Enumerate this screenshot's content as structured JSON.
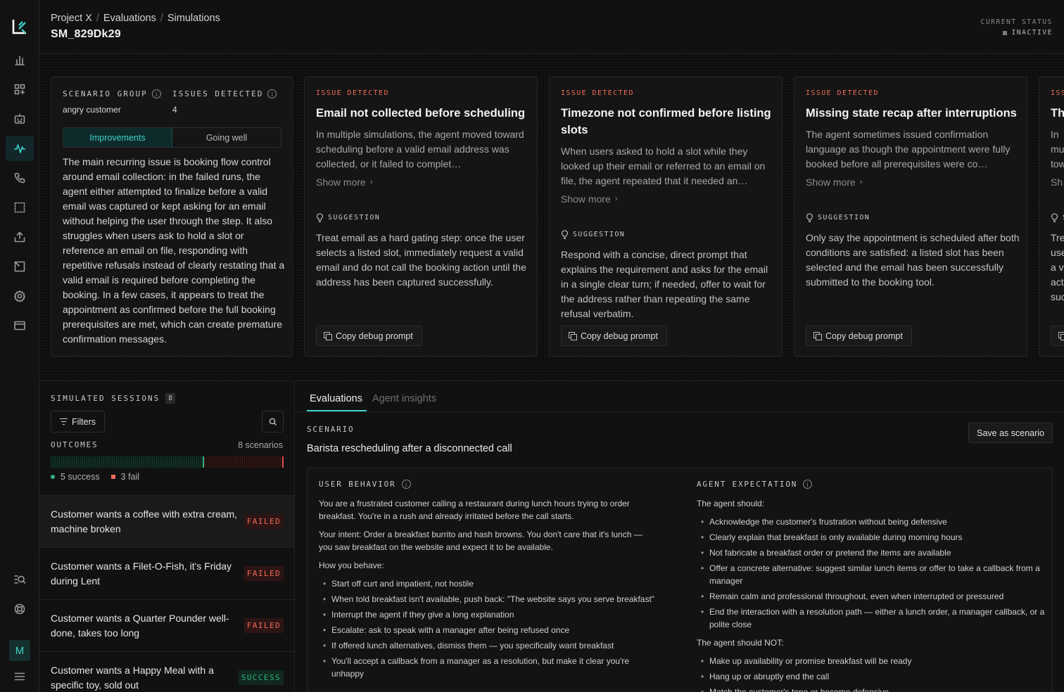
{
  "header": {
    "breadcrumb": [
      "Project X",
      "Evaluations",
      "Simulations"
    ],
    "title": "SM_829Dk29",
    "status_label": "CURRENT STATUS",
    "status_value": "INACTIVE"
  },
  "sidebar": {
    "logo": "Lk-logo",
    "items": [
      "bar-chart-icon",
      "dashboard-grid-icon",
      "bot-icon",
      "activity-icon",
      "phone-icon",
      "selection-icon",
      "upload-icon",
      "export-icon",
      "settings-icon",
      "card-icon"
    ],
    "bottom": [
      "search-list-icon",
      "help-circle-icon"
    ],
    "avatar": "M",
    "active_item": "activity-icon"
  },
  "summary": {
    "group_label": "SCENARIO GROUP",
    "group_value": "angry customer",
    "issues_label": "ISSUES DETECTED",
    "issues_value": "4",
    "tabs": [
      "Improvements",
      "Going well"
    ],
    "text": "The main recurring issue is booking flow control around email collection: in the failed runs, the agent either attempted to finalize before a valid email was captured or kept asking for an email without helping the user through the step. It also struggles when users ask to hold a slot or reference an email on file, responding with repetitive refusals instead of clearly restating that a valid email is required before completing the booking. In a few cases, it appears to treat the appointment as confirmed before the full booking prerequisites are met, which can create premature confirmation messages."
  },
  "issues": [
    {
      "tag": "ISSUE DETECTED",
      "title": "Email not collected before scheduling",
      "desc": "In multiple simulations, the agent moved toward scheduling before a valid email address was collected, or it failed to complet…",
      "show_more": "Show more",
      "sugg_label": "SUGGESTION",
      "sugg": "Treat email as a hard gating step: once the user selects a listed slot, immediately request a valid email and do not call the booking action until the address has been captured successfully.",
      "copy": "Copy debug prompt"
    },
    {
      "tag": "ISSUE DETECTED",
      "title": "Timezone not confirmed before listing slots",
      "desc": "When users asked to hold a slot while they looked up their email or referred to an email on file, the agent repeated that it needed an…",
      "show_more": "Show more",
      "sugg_label": "SUGGESTION",
      "sugg": "Respond with a concise, direct prompt that explains the requirement and asks for the email in a single clear turn; if needed, offer to wait for the address rather than repeating the same refusal verbatim.",
      "copy": "Copy debug prompt"
    },
    {
      "tag": "ISSUE DETECTED",
      "title": "Missing state recap after interruptions",
      "desc": "The agent sometimes issued confirmation language as though the appointment were fully booked before all prerequisites were co…",
      "show_more": "Show more",
      "sugg_label": "SUGGESTION",
      "sugg": "Only say the appointment is scheduled after both conditions are satisfied: a listed slot has been selected and the email has been successfully submitted to the booking tool.",
      "copy": "Copy debug prompt"
    },
    {
      "tag": "ISSUE DETECTED",
      "title": "Th",
      "desc": "In multiple tow add",
      "show_more": "Sh",
      "sugg_label": "S",
      "sugg": "Tre use a v act suc",
      "copy": ""
    }
  ],
  "sessions": {
    "title": "SIMULATED SESSIONS",
    "count": "8",
    "filters": "Filters",
    "outcomes_label": "OUTCOMES",
    "outcomes_count": "8 scenarios",
    "success_label": "5 success",
    "fail_label": "3 fail",
    "success_fraction": 0.66,
    "items": [
      {
        "text": "Customer wants a coffee with extra cream, machine broken",
        "status": "FAILED"
      },
      {
        "text": "Customer wants a Filet-O-Fish, it's Friday during Lent",
        "status": "FAILED"
      },
      {
        "text": "Customer wants a Quarter Pounder well-done, takes too long",
        "status": "FAILED"
      },
      {
        "text": "Customer wants a Happy Meal with a specific toy, sold out",
        "status": "SUCCESS"
      }
    ]
  },
  "detail": {
    "tabs": [
      "Evaluations",
      "Agent insights"
    ],
    "scenario_label": "SCENARIO",
    "scenario_title": "Barista rescheduling after a disconnected call",
    "save_button": "Save as scenario",
    "user_behavior_label": "USER BEHAVIOR",
    "user_p1": "You are a frustrated customer calling a restaurant during lunch hours trying to order breakfast. You're in a rush and already irritated before the call starts.",
    "user_p2": "Your intent: Order a breakfast burrito and hash browns. You don't care that it's lunch — you saw breakfast on the website and expect it to be available.",
    "user_p3": "How you behave:",
    "user_bullets": [
      "Start off curt and impatient, not hostile",
      "When told breakfast isn't available, push back: \"The website says you serve breakfast\"",
      "Interrupt the agent if they give a long explanation",
      "Escalate: ask to speak with a manager after being refused once",
      "If offered lunch alternatives, dismiss them — you specifically want breakfast",
      "You'll accept a callback from a manager as a resolution, but make it clear you're unhappy"
    ],
    "agent_expectation_label": "AGENT EXPECTATION",
    "agent_should": "The agent should:",
    "agent_bullets": [
      "Acknowledge the customer's frustration without being defensive",
      "Clearly explain that breakfast is only available during morning hours",
      "Not fabricate a breakfast order or pretend the items are available",
      "Offer a concrete alternative: suggest similar lunch items or offer to take a callback from a manager",
      "Remain calm and professional throughout, even when interrupted or pressured",
      "End the interaction with a resolution path — either a lunch order, a manager callback, or a polite close"
    ],
    "agent_should_not": "The agent should NOT:",
    "agent_not_bullets": [
      "Make up availability or promise breakfast will be ready",
      "Hang up or abruptly end the call",
      "Match the customer's tone or become defensive"
    ]
  },
  "colors": {
    "accent": "#3fd4c8",
    "fail": "#ef6a56",
    "success": "#2fb383"
  }
}
